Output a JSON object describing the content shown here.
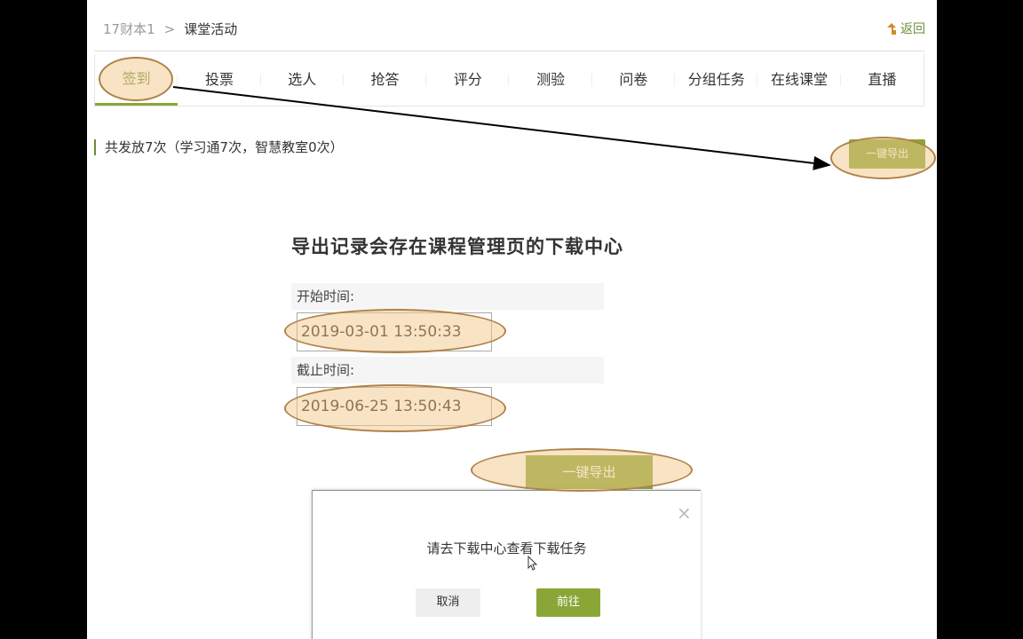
{
  "breadcrumb": {
    "course": "17财本1",
    "separator": ">",
    "current": "课堂活动"
  },
  "back_label": "返回",
  "tabs": [
    "签到",
    "投票",
    "选人",
    "抢答",
    "评分",
    "测验",
    "问卷",
    "分组任务",
    "在线课堂",
    "直播"
  ],
  "active_tab": "签到",
  "stats": "共发放7次（学习通7次，智慧教室0次）",
  "export_button_small": "一键导出",
  "export_dialog": {
    "title": "导出记录会存在课程管理页的下载中心",
    "start_label": "开始时间:",
    "start_value": "2019-03-01 13:50:33",
    "end_label": "截止时间:",
    "end_value": "2019-06-25 13:50:43",
    "export_button": "一键导出"
  },
  "confirm_popup": {
    "close_symbol": "×",
    "message": "请去下载中心查看下载任务",
    "cancel_label": "取消",
    "go_label": "前往"
  },
  "colors": {
    "accent": "#8aa637",
    "annotation": "#f2c88c"
  }
}
